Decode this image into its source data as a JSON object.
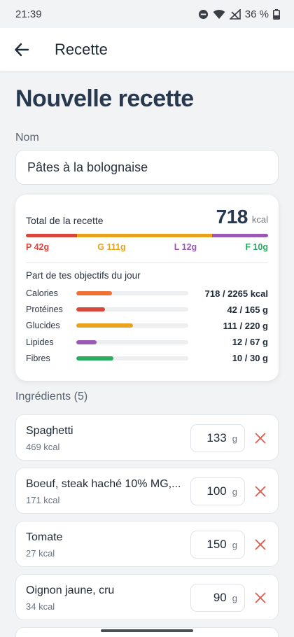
{
  "status_bar": {
    "time": "21:39",
    "battery": "36 %"
  },
  "app_bar": {
    "title": "Recette"
  },
  "page_title": "Nouvelle recette",
  "name_field": {
    "label": "Nom",
    "value": "Pâtes à la bolognaise"
  },
  "summary": {
    "total_label": "Total de la recette",
    "total_kcal": "718",
    "total_unit": "kcal",
    "macro_bar": [
      {
        "key": "P",
        "fraction": 0.21,
        "color": "#d9463e"
      },
      {
        "key": "G",
        "fraction": 0.56,
        "color": "#e8a21f"
      },
      {
        "key": "L",
        "fraction": 0.13,
        "color": "#9b59b6"
      },
      {
        "key": "F",
        "fraction": 0.1,
        "color": "#9b59b6"
      }
    ],
    "macro_labels": [
      {
        "text": "P 42g",
        "color": "#d9463e"
      },
      {
        "text": "G 111g",
        "color": "#e8a21f"
      },
      {
        "text": "L 12g",
        "color": "#9b59b6"
      },
      {
        "text": "F 10g",
        "color": "#27ae60"
      }
    ],
    "goals_title": "Part de tes objectifs du jour",
    "goals": [
      {
        "name": "Calories",
        "value": "718 / 2265 kcal",
        "progress": 0.317,
        "color": "#ee7033"
      },
      {
        "name": "Protéines",
        "value": "42 / 165 g",
        "progress": 0.255,
        "color": "#d9463e"
      },
      {
        "name": "Glucides",
        "value": "111 / 220 g",
        "progress": 0.505,
        "color": "#e8a21f"
      },
      {
        "name": "Lipides",
        "value": "12 / 67 g",
        "progress": 0.179,
        "color": "#9b59b6"
      },
      {
        "name": "Fibres",
        "value": "10 / 30 g",
        "progress": 0.333,
        "color": "#27ae60"
      }
    ]
  },
  "ingredients_title": "Ingrédients (5)",
  "ingredients": [
    {
      "name": "Spaghetti",
      "kcal": "469 kcal",
      "quantity": "133",
      "unit": "g"
    },
    {
      "name": "Boeuf, steak haché 10% MG,...",
      "kcal": "171 kcal",
      "quantity": "100",
      "unit": "g"
    },
    {
      "name": "Tomate",
      "kcal": "27 kcal",
      "quantity": "150",
      "unit": "g"
    },
    {
      "name": "Oignon jaune, cru",
      "kcal": "34 kcal",
      "quantity": "90",
      "unit": "g"
    }
  ]
}
